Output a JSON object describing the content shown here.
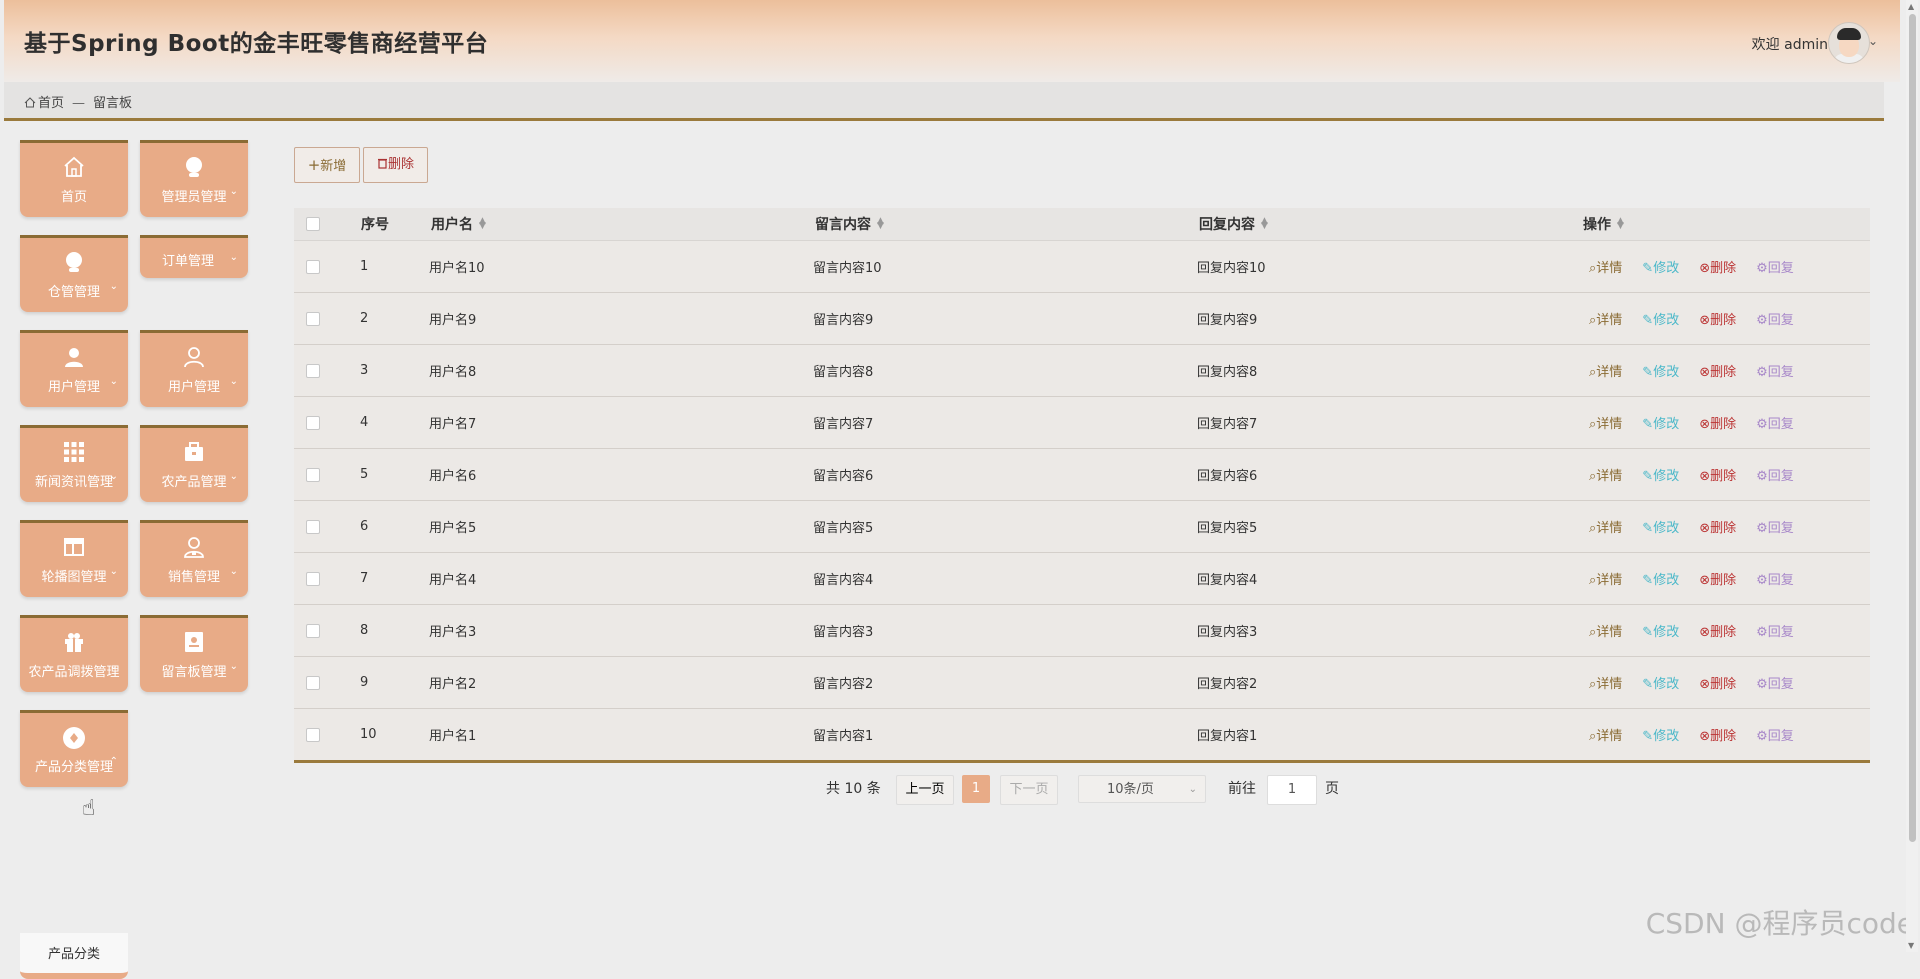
{
  "header": {
    "title": "基于Spring Boot的金丰旺零售商经营平台",
    "welcome": "欢迎 admin",
    "dropdown_icon": "chevron-down-icon"
  },
  "breadcrumb": {
    "home": "首页",
    "separator": "—",
    "current": "留言板"
  },
  "sidebar": {
    "items": [
      {
        "label": "首页",
        "icon": "home-icon"
      },
      {
        "label": "管理员管理",
        "icon": "admin-icon"
      },
      {
        "label": "仓管管理",
        "icon": "warehouse-user-icon"
      },
      {
        "label": "订单管理",
        "icon": ""
      },
      {
        "label": "用户管理",
        "icon": "user-solid-icon"
      },
      {
        "label": "用户管理",
        "icon": "user-outline-icon"
      },
      {
        "label": "新闻资讯管理",
        "icon": "grid-icon"
      },
      {
        "label": "农产品管理",
        "icon": "briefcase-icon"
      },
      {
        "label": "轮播图管理",
        "icon": "layout-icon"
      },
      {
        "label": "销售管理",
        "icon": "user-badge-icon"
      },
      {
        "label": "农产品调拨管理",
        "icon": "gift-icon"
      },
      {
        "label": "留言板管理",
        "icon": "contact-card-icon"
      },
      {
        "label": "产品分类管理",
        "icon": "category-icon"
      }
    ],
    "submenu_item": "产品分类"
  },
  "toolbar": {
    "add_label": "新增",
    "delete_label": "删除"
  },
  "table": {
    "columns": [
      "序号",
      "用户名",
      "留言内容",
      "回复内容",
      "操作"
    ],
    "actions": {
      "detail": "详情",
      "edit": "修改",
      "delete": "删除",
      "reply": "回复"
    },
    "rows": [
      {
        "no": "1",
        "user": "用户名10",
        "msg": "留言内容10",
        "reply": "回复内容10"
      },
      {
        "no": "2",
        "user": "用户名9",
        "msg": "留言内容9",
        "reply": "回复内容9"
      },
      {
        "no": "3",
        "user": "用户名8",
        "msg": "留言内容8",
        "reply": "回复内容8"
      },
      {
        "no": "4",
        "user": "用户名7",
        "msg": "留言内容7",
        "reply": "回复内容7"
      },
      {
        "no": "5",
        "user": "用户名6",
        "msg": "留言内容6",
        "reply": "回复内容6"
      },
      {
        "no": "6",
        "user": "用户名5",
        "msg": "留言内容5",
        "reply": "回复内容5"
      },
      {
        "no": "7",
        "user": "用户名4",
        "msg": "留言内容4",
        "reply": "回复内容4"
      },
      {
        "no": "8",
        "user": "用户名3",
        "msg": "留言内容3",
        "reply": "回复内容3"
      },
      {
        "no": "9",
        "user": "用户名2",
        "msg": "留言内容2",
        "reply": "回复内容2"
      },
      {
        "no": "10",
        "user": "用户名1",
        "msg": "留言内容1",
        "reply": "回复内容1"
      }
    ]
  },
  "pagination": {
    "total": "共 10 条",
    "prev": "上一页",
    "current_page": "1",
    "next": "下一页",
    "page_size": "10条/页",
    "goto_label": "前往",
    "goto_value": "1",
    "page_suffix": "页"
  },
  "watermark": "CSDN @程序员code",
  "colors": {
    "accent": "#e8ab87",
    "border_gold": "#9a7a3c",
    "detail": "#8a6b34",
    "edit": "#4bb8c9",
    "delete": "#b33333",
    "reply": "#a888c9"
  }
}
